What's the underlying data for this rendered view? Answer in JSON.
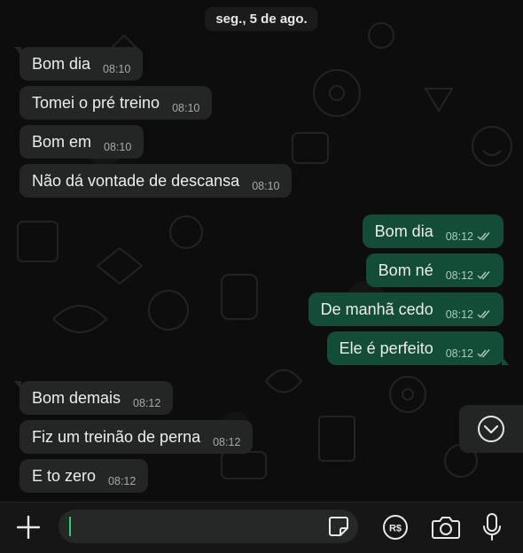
{
  "chat": {
    "date_separator": "seg., 5 de ago.",
    "incoming_top": [
      {
        "text": "Bom dia",
        "time": "08:10"
      },
      {
        "text": "Tomei o pré treino",
        "time": "08:10"
      },
      {
        "text": "Bom em",
        "time": "08:10"
      },
      {
        "text": "Não dá vontade de descansa",
        "time": "08:10"
      }
    ],
    "outgoing": [
      {
        "text": "Bom dia",
        "time": "08:12",
        "status": "read"
      },
      {
        "text": "Bom né",
        "time": "08:12",
        "status": "read"
      },
      {
        "text": "De manhã cedo",
        "time": "08:12",
        "status": "read"
      },
      {
        "text": "Ele é perfeito",
        "time": "08:12",
        "status": "read"
      }
    ],
    "incoming_bottom": [
      {
        "text": "Bom demais",
        "time": "08:12"
      },
      {
        "text": "Fiz um treinão de perna",
        "time": "08:12"
      },
      {
        "text": "E to zero",
        "time": "08:12"
      }
    ]
  },
  "composer": {
    "value": "",
    "icons": [
      "plus-icon",
      "sticker-icon",
      "payment-icon",
      "camera-icon",
      "microphone-icon"
    ]
  },
  "colors": {
    "incoming_bubble": "#242626",
    "outgoing_bubble": "#134d37",
    "accent": "#25d366",
    "read_ticks": "#a9c9ba"
  }
}
